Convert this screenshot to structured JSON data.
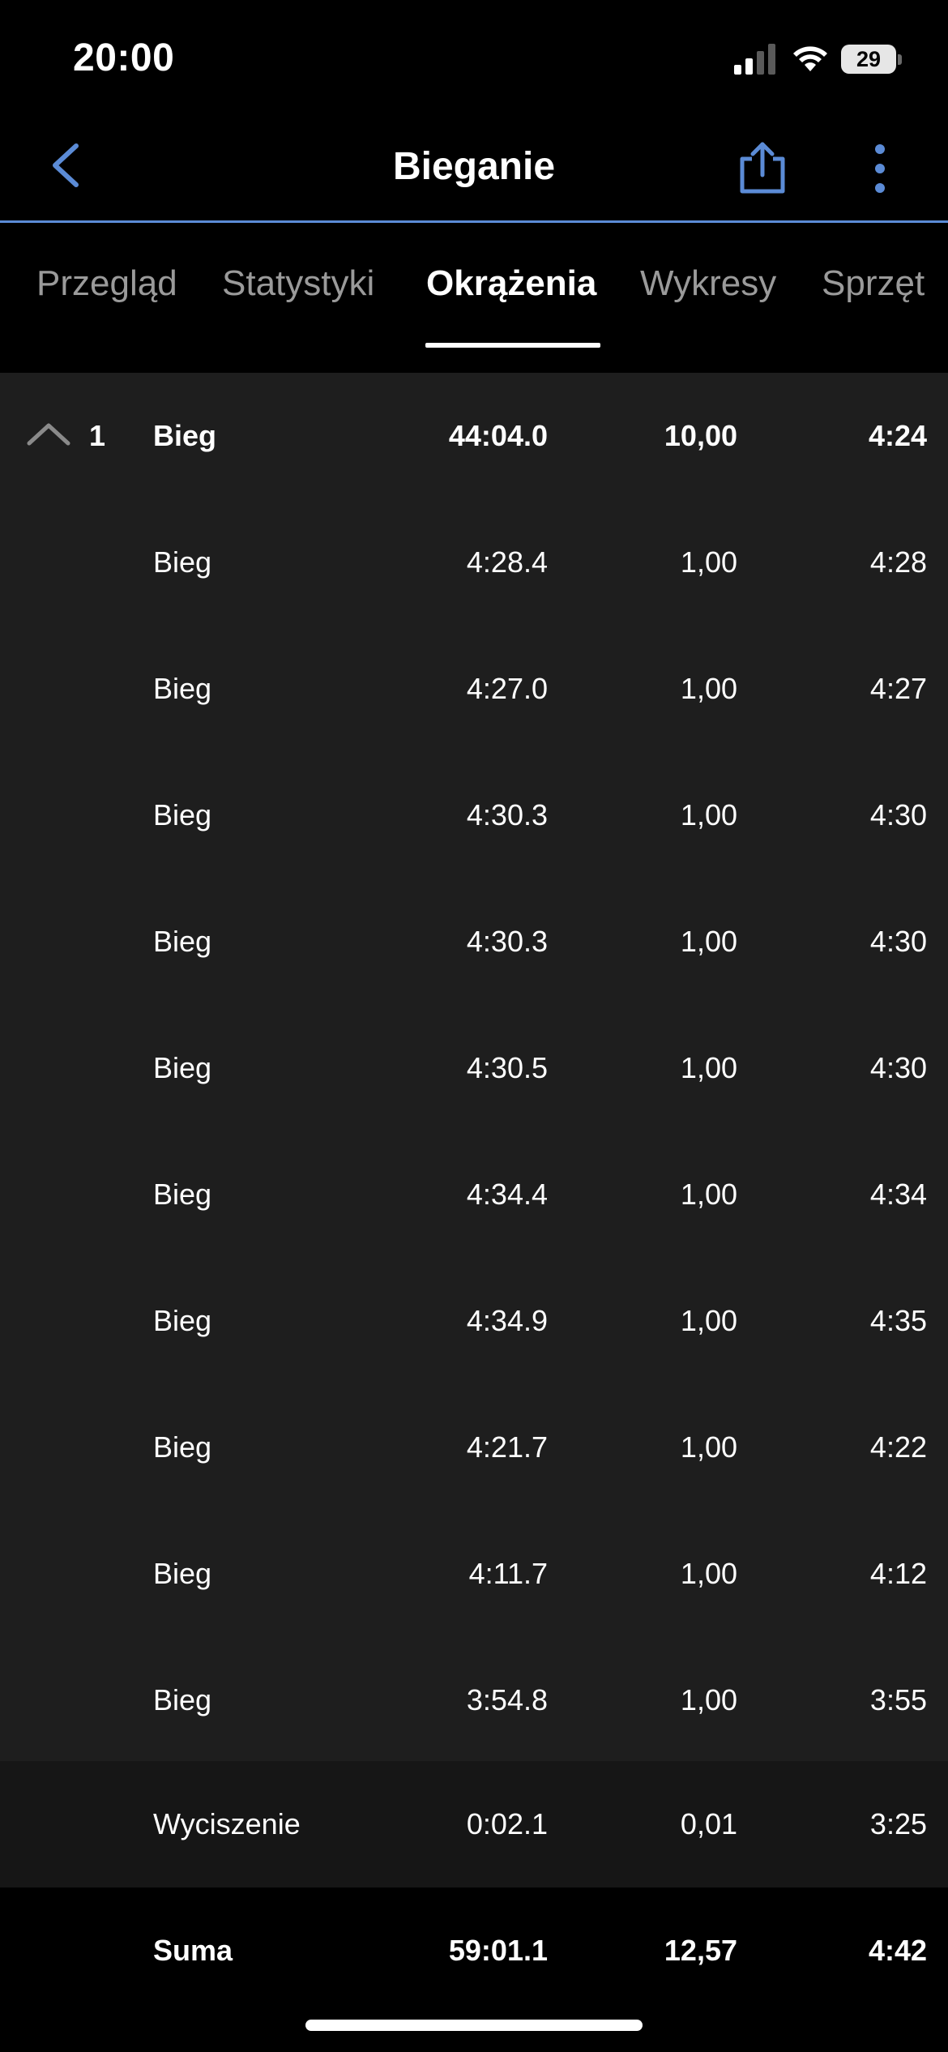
{
  "status_bar": {
    "time": "20:00",
    "battery": "29"
  },
  "header": {
    "title": "Bieganie"
  },
  "tabs": [
    {
      "label": "Przegląd"
    },
    {
      "label": "Statystyki"
    },
    {
      "label": "Okrążenia"
    },
    {
      "label": "Wykresy"
    },
    {
      "label": "Sprzęt"
    }
  ],
  "active_tab": "Okrążenia",
  "accent_color": "#5b8bd6",
  "group": {
    "number": "1",
    "name": "Bieg",
    "time": "44:04.0",
    "distance": "10,00",
    "pace": "4:24",
    "expanded": true
  },
  "laps": [
    {
      "name": "Bieg",
      "time": "4:28.4",
      "distance": "1,00",
      "pace": "4:28"
    },
    {
      "name": "Bieg",
      "time": "4:27.0",
      "distance": "1,00",
      "pace": "4:27"
    },
    {
      "name": "Bieg",
      "time": "4:30.3",
      "distance": "1,00",
      "pace": "4:30"
    },
    {
      "name": "Bieg",
      "time": "4:30.3",
      "distance": "1,00",
      "pace": "4:30"
    },
    {
      "name": "Bieg",
      "time": "4:30.5",
      "distance": "1,00",
      "pace": "4:30"
    },
    {
      "name": "Bieg",
      "time": "4:34.4",
      "distance": "1,00",
      "pace": "4:34"
    },
    {
      "name": "Bieg",
      "time": "4:34.9",
      "distance": "1,00",
      "pace": "4:35"
    },
    {
      "name": "Bieg",
      "time": "4:21.7",
      "distance": "1,00",
      "pace": "4:22"
    },
    {
      "name": "Bieg",
      "time": "4:11.7",
      "distance": "1,00",
      "pace": "4:12"
    },
    {
      "name": "Bieg",
      "time": "3:54.8",
      "distance": "1,00",
      "pace": "3:55"
    }
  ],
  "cooldown": {
    "name": "Wyciszenie",
    "time": "0:02.1",
    "distance": "0,01",
    "pace": "3:25"
  },
  "total": {
    "name": "Suma",
    "time": "59:01.1",
    "distance": "12,57",
    "pace": "4:42"
  }
}
